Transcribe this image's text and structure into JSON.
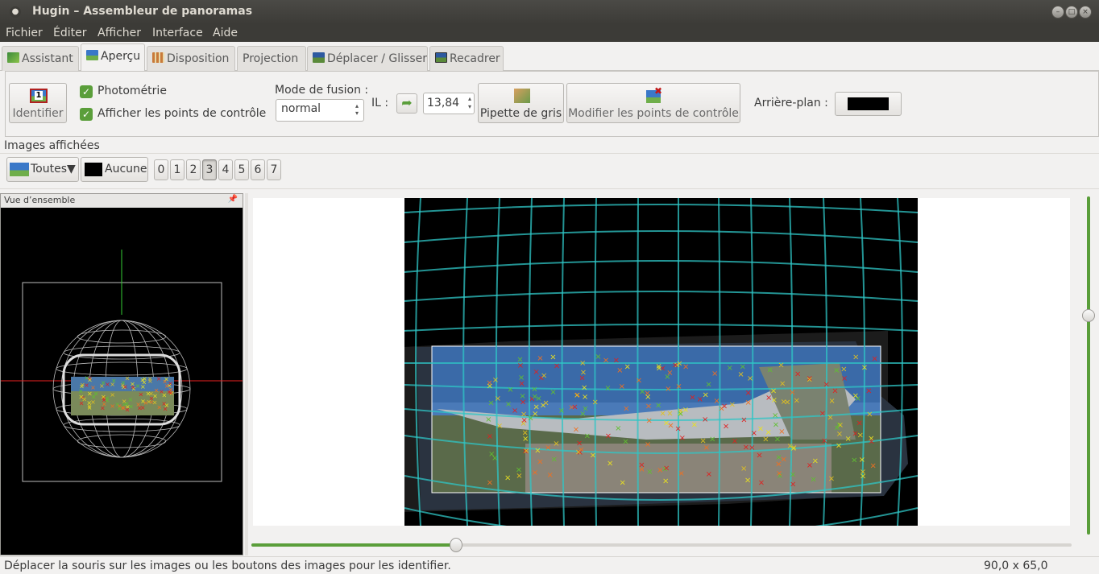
{
  "window": {
    "title": "Hugin – Assembleur de panoramas"
  },
  "menu": [
    "Fichier",
    "Éditer",
    "Afficher",
    "Interface",
    "Aide"
  ],
  "tabs": [
    {
      "label": "Assistant",
      "icon": "wizard-icon",
      "active": false
    },
    {
      "label": "Aperçu",
      "icon": "preview-icon",
      "active": true
    },
    {
      "label": "Disposition",
      "icon": "layout-icon",
      "active": false
    },
    {
      "label": "Projection",
      "icon": "",
      "active": false
    },
    {
      "label": "Déplacer / Glisser",
      "icon": "move-icon",
      "active": false
    },
    {
      "label": "Recadrer",
      "icon": "crop-icon",
      "active": false
    }
  ],
  "toolbar": {
    "identify_label": "Identifier",
    "identify_badge": "1",
    "photometry_label": "Photométrie",
    "photometry_checked": true,
    "show_cp_label": "Afficher les points de contrôle",
    "show_cp_checked": true,
    "blend_mode_label": "Mode de fusion :",
    "blend_mode_value": "normal",
    "ev_label": "IL :",
    "ev_value": "13,84",
    "gray_picker_label": "Pipette de gris",
    "edit_cp_label": "Modifier les points de contrôle",
    "background_label": "Arrière-plan :",
    "background_color": "#000000"
  },
  "images": {
    "section_label": "Images affichées",
    "all_label": "Toutes▼",
    "none_label": "Aucune",
    "numbers": [
      "0",
      "1",
      "2",
      "3",
      "4",
      "5",
      "6",
      "7"
    ],
    "selected": "3"
  },
  "overview": {
    "title": "Vue d’ensemble"
  },
  "status": {
    "message": "Déplacer la souris sur les images ou les boutons des images pour les identifier.",
    "dimensions": "90,0 x 65,0"
  },
  "colors": {
    "accent": "#5a9e3a",
    "grid": "#2fc6c6",
    "titlebar": "#3c3b37"
  }
}
